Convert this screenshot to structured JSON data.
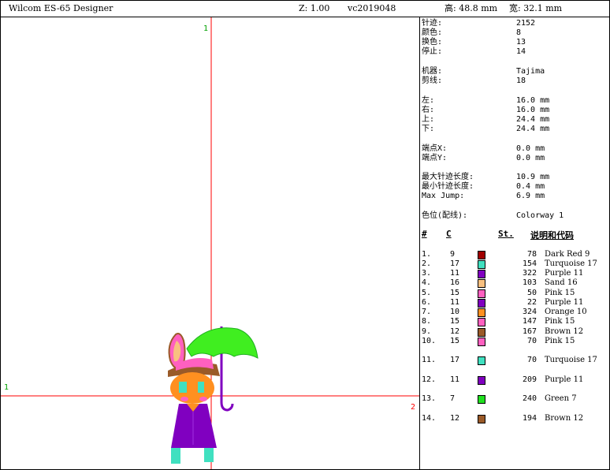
{
  "header": {
    "app_title": "Wilcom ES-65 Designer",
    "zoom": "Z: 1.00",
    "file_name": "vc2019048",
    "height_label": "高: 48.8 mm",
    "width_label": "宽: 32.1 mm"
  },
  "canvas": {
    "label_top": "1",
    "label_left": "1",
    "label_right": "2",
    "crosshair_color": "#ff0000"
  },
  "info": {
    "stitches_label": "针迹:",
    "stitches_value": "2152",
    "colors_label": "颜色:",
    "colors_value": "8",
    "changes_label": "换色:",
    "changes_value": "13",
    "stops_label": "停止:",
    "stops_value": "14",
    "machine_label": "机器:",
    "machine_value": "Tajima",
    "trims_label": "剪线:",
    "trims_value": "18",
    "left_label": "左:",
    "left_value": "16.0 mm",
    "right_label": "右:",
    "right_value": "16.0 mm",
    "up_label": "上:",
    "up_value": "24.4 mm",
    "down_label": "下:",
    "down_value": "24.4 mm",
    "endx_label": "端点X:",
    "endx_value": "0.0 mm",
    "endy_label": "端点Y:",
    "endy_value": "0.0 mm",
    "maxlen_label": "最大针迹长度:",
    "maxlen_value": "10.9 mm",
    "minlen_label": "最小针迹长度:",
    "minlen_value": "0.4 mm",
    "maxjump_label": "Max Jump:",
    "maxjump_value": "6.9 mm",
    "colorway_label": "色位(配线):",
    "colorway_value": "Colorway 1"
  },
  "table": {
    "col_num": "#",
    "col_code": "C",
    "col_st": "St.",
    "col_desc": "说明和代码",
    "rows": [
      {
        "idx": "1.",
        "code": "9",
        "color": "#a00000",
        "st": "78",
        "name": "Dark Red 9"
      },
      {
        "idx": "2.",
        "code": "17",
        "color": "#40e0c0",
        "st": "154",
        "name": "Turquoise 17"
      },
      {
        "idx": "3.",
        "code": "11",
        "color": "#8000c0",
        "st": "322",
        "name": "Purple 11"
      },
      {
        "idx": "4.",
        "code": "16",
        "color": "#f8c080",
        "st": "103",
        "name": "Sand 16"
      },
      {
        "idx": "5.",
        "code": "15",
        "color": "#ff60c0",
        "st": "50",
        "name": "Pink 15"
      },
      {
        "idx": "6.",
        "code": "11",
        "color": "#8000c0",
        "st": "22",
        "name": "Purple 11"
      },
      {
        "idx": "7.",
        "code": "10",
        "color": "#ff9020",
        "st": "324",
        "name": "Orange 10"
      },
      {
        "idx": "8.",
        "code": "15",
        "color": "#ff60c0",
        "st": "147",
        "name": "Pink 15"
      },
      {
        "idx": "9.",
        "code": "12",
        "color": "#9a5a28",
        "st": "167",
        "name": "Brown 12"
      },
      {
        "idx": "10.",
        "code": "15",
        "color": "#ff60c0",
        "st": "70",
        "name": "Pink 15"
      },
      {
        "idx": "11.",
        "code": "17",
        "color": "#40e0c0",
        "st": "70",
        "name": "Turquoise 17"
      },
      {
        "idx": "12.",
        "code": "11",
        "color": "#8000c0",
        "st": "209",
        "name": "Purple 11"
      },
      {
        "idx": "13.",
        "code": "7",
        "color": "#20e020",
        "st": "240",
        "name": "Green 7"
      },
      {
        "idx": "14.",
        "code": "12",
        "color": "#9a5a28",
        "st": "194",
        "name": "Brown 12"
      }
    ]
  }
}
